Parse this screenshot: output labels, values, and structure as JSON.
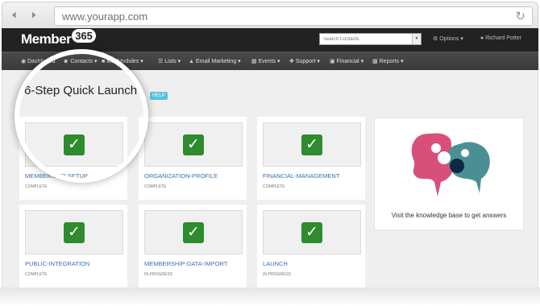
{
  "browser": {
    "url": "www.yourapp.com",
    "back_icon": "arrow-left-icon",
    "forward_icon": "arrow-right-icon",
    "reload_icon": "reload-icon"
  },
  "header": {
    "logo_text": "Member",
    "logo_badge": "365",
    "search_placeholder": "Search Contacts",
    "options_label": "Options",
    "user_name": "Richard Potter"
  },
  "menu": [
    {
      "label": "Dashboard",
      "icon": "dashboard-icon"
    },
    {
      "label": "Contacts",
      "icon": "contacts-icon"
    },
    {
      "label": "ModModules",
      "icon": "modules-icon"
    },
    {
      "label": "Lists",
      "icon": "lists-icon"
    },
    {
      "label": "Email Marketing",
      "icon": "megaphone-icon"
    },
    {
      "label": "Events",
      "icon": "calendar-icon"
    },
    {
      "label": "Support",
      "icon": "support-icon"
    },
    {
      "label": "Financial",
      "icon": "financial-icon"
    },
    {
      "label": "Reports",
      "icon": "reports-icon"
    }
  ],
  "page": {
    "title": "6-Step Quick Launch",
    "help_label": "HELP"
  },
  "steps": [
    {
      "title": "MEMBERSHIP-SETUP",
      "status": "COMPLETE"
    },
    {
      "title": "ORGANIZATION-PROFILE",
      "status": "COMPLETE"
    },
    {
      "title": "FINANCIAL-MANAGEMENT",
      "status": "COMPLETE"
    },
    {
      "title": "PUBLIC-INTEGRATION",
      "status": "COMPLETE"
    },
    {
      "title": "MEMBERSHIP-DATA-IMPORT",
      "status": "IN-PROGRESS"
    },
    {
      "title": "LAUNCH",
      "status": "IN-PROGRESS"
    }
  ],
  "knowledge_base": {
    "text": "Visit the knowledge base to get answers"
  },
  "colors": {
    "check_green": "#2e8b2e",
    "link_blue": "#3a6fb0",
    "help_blue": "#5bc0de",
    "header_dark": "#222222"
  }
}
